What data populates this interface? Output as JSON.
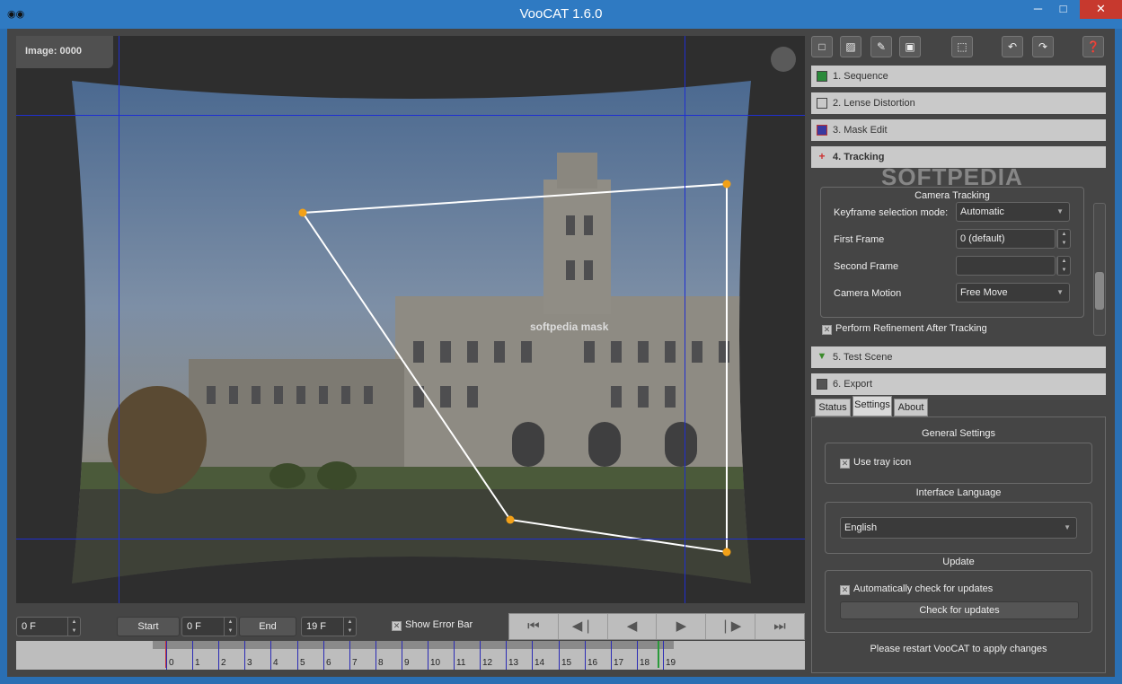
{
  "window": {
    "title": "VooCAT 1.6.0",
    "minimize": "─",
    "maximize": "□",
    "close": "✕"
  },
  "viewport": {
    "image_label": "Image: 0000",
    "mask_label": "softpedia mask"
  },
  "bottom": {
    "current_frame": "0 F",
    "start_label": "Start",
    "start_frame": "0 F",
    "end_label": "End",
    "end_frame": "19 F",
    "show_error_bar": "Show Error Bar",
    "transport": [
      "⏮",
      "◀❘",
      "◀",
      "▶",
      "❘▶",
      "⏭"
    ]
  },
  "timeline": {
    "frames": [
      "0",
      "1",
      "2",
      "3",
      "4",
      "5",
      "6",
      "7",
      "8",
      "9",
      "10",
      "11",
      "12",
      "13",
      "14",
      "15",
      "16",
      "17",
      "18",
      "19"
    ]
  },
  "toolbar": {
    "new": "□",
    "open": "▨",
    "edit": "✎",
    "save": "▣",
    "select": "⬚",
    "undo": "↶",
    "redo": "↷",
    "help": "❓"
  },
  "sections": [
    {
      "label": "1. Sequence"
    },
    {
      "label": "2. Lense Distortion"
    },
    {
      "label": "3. Mask Edit"
    },
    {
      "label": "4. Tracking"
    },
    {
      "label": "5. Test Scene"
    },
    {
      "label": "6. Export"
    }
  ],
  "watermark": "SOFTPEDIA",
  "tracking": {
    "group_title": "Camera Tracking",
    "keyframe_mode_label": "Keyframe selection mode:",
    "keyframe_mode_value": "Automatic",
    "first_frame_label": "First Frame",
    "first_frame_value": "0 (default)",
    "second_frame_label": "Second Frame",
    "second_frame_value": "",
    "camera_motion_label": "Camera Motion",
    "camera_motion_value": "Free Move",
    "refine_label": "Perform Refinement After Tracking"
  },
  "tabs": [
    "Status",
    "Settings",
    "About"
  ],
  "settings": {
    "general_title": "General Settings",
    "tray_icon": "Use tray icon",
    "language_title": "Interface Language",
    "language_value": "English",
    "update_title": "Update",
    "auto_check": "Automatically check for updates",
    "check_button": "Check for updates",
    "restart_note": "Please restart VooCAT to apply changes"
  }
}
